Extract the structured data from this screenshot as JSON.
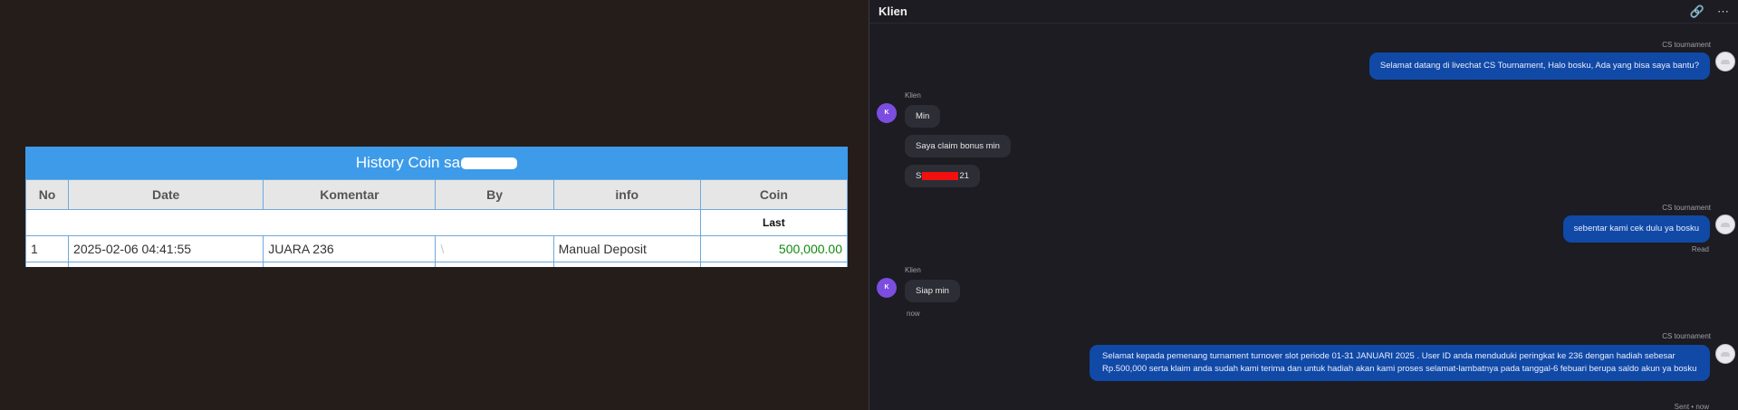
{
  "table": {
    "title_prefix": "History Coin sa",
    "headers": [
      "No",
      "Date",
      "Komentar",
      "By",
      "info",
      "Coin"
    ],
    "last_label": "Last",
    "rows": [
      {
        "no": "1",
        "date": "2025-02-06 04:41:55",
        "komentar": "JUARA 236",
        "by": "\\",
        "info": "Manual Deposit",
        "coin": "500,000.00"
      }
    ]
  },
  "chat": {
    "title": "Klien",
    "icons": [
      "link-icon",
      "more-icon"
    ],
    "sender_cs": "CS tournament",
    "sender_client": "Klien",
    "client_initial": "K",
    "messages": {
      "m1": "Selamat datang di livechat CS Tournament, Halo bosku, Ada yang bisa saya bantu?",
      "m2": "Min",
      "m3": "Saya claim bonus min",
      "m4_prefix": "S",
      "m4_suffix": "21",
      "m5": "sebentar kami cek dulu ya bosku",
      "m5_status": "Read",
      "m6": "Siap min",
      "m6_time": "now",
      "m7": "Selamat kepada pemenang turnament turnover slot periode 01-31 JANUARI 2025 . User ID anda menduduki peringkat ke 236 dengan hadiah sebesar Rp.500,000 serta klaim anda sudah kami terima dan untuk hadiah akan kami proses selamat-lambatnya pada tanggal-6 febuari berupa saldo akun ya bosku",
      "m7_status": "Sent • now"
    }
  },
  "colors": {
    "table_header": "#3d9be9",
    "coin_value": "#108a10",
    "outgoing_bubble": "#1149a7",
    "incoming_bubble": "#2d2d35",
    "client_avatar": "#7b4de0",
    "redaction": "#f01010"
  }
}
